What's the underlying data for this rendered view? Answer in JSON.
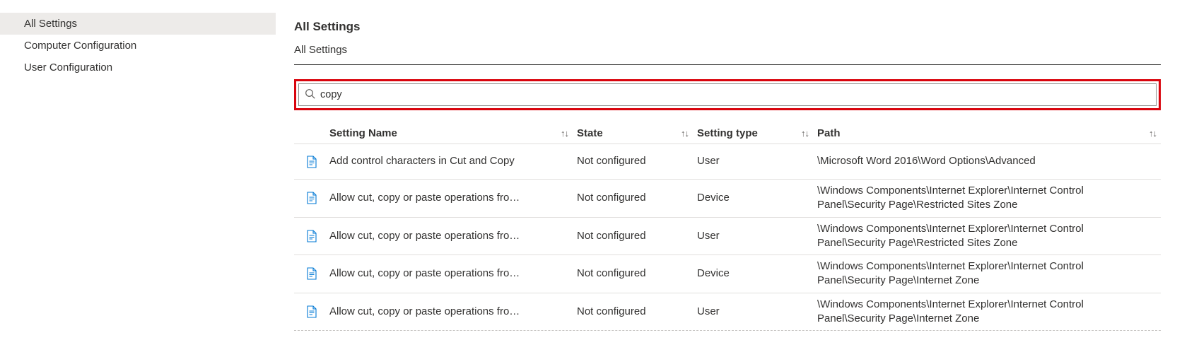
{
  "sidebar": {
    "items": [
      {
        "label": "All Settings",
        "active": true
      },
      {
        "label": "Computer Configuration",
        "active": false
      },
      {
        "label": "User Configuration",
        "active": false
      }
    ]
  },
  "header": {
    "title": "All Settings",
    "breadcrumb": "All Settings"
  },
  "search": {
    "value": "copy"
  },
  "columns": {
    "name": "Setting Name",
    "state": "State",
    "type": "Setting type",
    "path": "Path"
  },
  "sort_glyph": "↑↓",
  "rows": [
    {
      "name": "Add control characters in Cut and Copy",
      "state": "Not configured",
      "type": "User",
      "path": "\\Microsoft Word 2016\\Word Options\\Advanced"
    },
    {
      "name": "Allow cut, copy or paste operations fro…",
      "state": "Not configured",
      "type": "Device",
      "path": "\\Windows Components\\Internet Explorer\\Internet Control Panel\\Security Page\\Restricted Sites Zone"
    },
    {
      "name": "Allow cut, copy or paste operations fro…",
      "state": "Not configured",
      "type": "User",
      "path": "\\Windows Components\\Internet Explorer\\Internet Control Panel\\Security Page\\Restricted Sites Zone"
    },
    {
      "name": "Allow cut, copy or paste operations fro…",
      "state": "Not configured",
      "type": "Device",
      "path": "\\Windows Components\\Internet Explorer\\Internet Control Panel\\Security Page\\Internet Zone"
    },
    {
      "name": "Allow cut, copy or paste operations fro…",
      "state": "Not configured",
      "type": "User",
      "path": "\\Windows Components\\Internet Explorer\\Internet Control Panel\\Security Page\\Internet Zone"
    }
  ]
}
